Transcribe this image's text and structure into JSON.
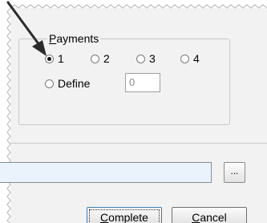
{
  "payments": {
    "title_first": "P",
    "title_rest": "ayments",
    "options": [
      {
        "label": "1",
        "checked": true
      },
      {
        "label": "2",
        "checked": false
      },
      {
        "label": "3",
        "checked": false
      },
      {
        "label": "4",
        "checked": false
      }
    ],
    "define_label": "Define",
    "define_value": "0",
    "define_checked": false
  },
  "browse": {
    "label": "..."
  },
  "buttons": {
    "complete_first": "C",
    "complete_rest": "omplete",
    "cancel_first": "C",
    "cancel_rest": "ancel"
  }
}
